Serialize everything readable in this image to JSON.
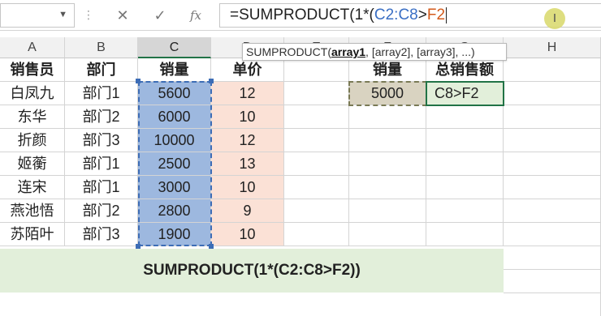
{
  "formula_bar": {
    "cancel_icon": "✕",
    "enter_icon": "✓",
    "fx_label": "fx",
    "formula_prefix": "=SUMPRODUCT(1*(",
    "formula_ref1": "C2:C8",
    "formula_op": ">",
    "formula_ref2": "F2"
  },
  "tooltip": {
    "fn": "SUMPRODUCT(",
    "arg1": "array1",
    "rest": ", [array2], [array3], ...)"
  },
  "columns": [
    "A",
    "B",
    "C",
    "D",
    "E",
    "F",
    "G",
    "H"
  ],
  "table": {
    "headers": [
      "销售员",
      "部门",
      "销量",
      "单价"
    ],
    "rows": [
      [
        "白凤九",
        "部门1",
        "5600",
        "12"
      ],
      [
        "东华",
        "部门2",
        "6000",
        "10"
      ],
      [
        "折颜",
        "部门3",
        "10000",
        "12"
      ],
      [
        "姬蘅",
        "部门1",
        "2500",
        "13"
      ],
      [
        "连宋",
        "部门1",
        "3000",
        "10"
      ],
      [
        "燕池悟",
        "部门2",
        "2800",
        "9"
      ],
      [
        "苏陌叶",
        "部门3",
        "1900",
        "10"
      ]
    ]
  },
  "side": {
    "headers": [
      "销量",
      "总销售额"
    ],
    "values": [
      "5000",
      "C8>F2"
    ]
  },
  "banner": "SUMPRODUCT(1*(C2:C8>F2))"
}
